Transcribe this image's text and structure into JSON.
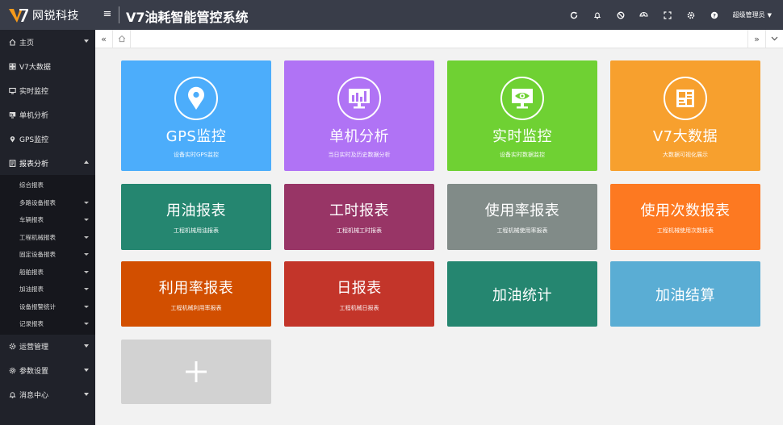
{
  "header": {
    "logo_mark": "V7",
    "logo_text": "网锐科技",
    "menu_toggle_icon": "≡",
    "app_title": "V7油耗智能管控系统",
    "icons": [
      "refresh-icon",
      "bell-icon",
      "block-icon",
      "palette-icon",
      "fullscreen-icon",
      "settings-icon",
      "help-icon"
    ],
    "user": "超级管理员"
  },
  "sidebar": {
    "items": [
      {
        "label": "主页",
        "icon": "home-icon",
        "arrow": "down"
      },
      {
        "label": "V7大数据",
        "icon": "grid-icon",
        "arrow": ""
      },
      {
        "label": "实时监控",
        "icon": "monitor-icon",
        "arrow": ""
      },
      {
        "label": "单机分析",
        "icon": "device-icon",
        "arrow": ""
      },
      {
        "label": "GPS监控",
        "icon": "location-icon",
        "arrow": ""
      },
      {
        "label": "报表分析",
        "icon": "report-icon",
        "arrow": "up"
      }
    ],
    "submenu": [
      {
        "label": "综合报表",
        "arrow": false
      },
      {
        "label": "多路设备报表",
        "arrow": true
      },
      {
        "label": "车辆报表",
        "arrow": true
      },
      {
        "label": "工程机械报表",
        "arrow": true
      },
      {
        "label": "固定设备报表",
        "arrow": true
      },
      {
        "label": "船舶报表",
        "arrow": true
      },
      {
        "label": "加油报表",
        "arrow": true
      },
      {
        "label": "设备报警统计",
        "arrow": true
      },
      {
        "label": "记录报表",
        "arrow": true
      }
    ],
    "bottom_items": [
      {
        "label": "运营管理",
        "icon": "gear-icon"
      },
      {
        "label": "参数设置",
        "icon": "settings-icon"
      },
      {
        "label": "消息中心",
        "icon": "bell-icon"
      }
    ]
  },
  "tabs": {
    "prev": "«",
    "next": "»"
  },
  "tiles": [
    {
      "title": "GPS监控",
      "sub": "设备实时GPS监控",
      "color": "#4cadfb",
      "icon": "location-icon"
    },
    {
      "title": "单机分析",
      "sub": "当日实时及历史数据分析",
      "color": "#b073f5",
      "icon": "chart-icon"
    },
    {
      "title": "实时监控",
      "sub": "设备实时数据监控",
      "color": "#6fd133",
      "icon": "eye-monitor-icon"
    },
    {
      "title": "V7大数据",
      "sub": "大数据可视化展示",
      "color": "#f7a02e",
      "icon": "bigdata-icon"
    },
    {
      "title": "用油报表",
      "sub": "工程机械用油报表",
      "color": "#258670"
    },
    {
      "title": "工时报表",
      "sub": "工程机械工时报表",
      "color": "#983566"
    },
    {
      "title": "使用率报表",
      "sub": "工程机械使用率报表",
      "color": "#818b88"
    },
    {
      "title": "使用次数报表",
      "sub": "工程机械使用次数报表",
      "color": "#fd7921"
    },
    {
      "title": "利用率报表",
      "sub": "工程机械利用率报表",
      "color": "#d24f00"
    },
    {
      "title": "日报表",
      "sub": "工程机械日报表",
      "color": "#c3352a"
    },
    {
      "title": "加油统计",
      "sub": "",
      "color": "#258670"
    },
    {
      "title": "加油结算",
      "sub": "",
      "color": "#5aadd4"
    }
  ],
  "add_tile": {
    "label": "+",
    "color": "#d2d2d2"
  }
}
